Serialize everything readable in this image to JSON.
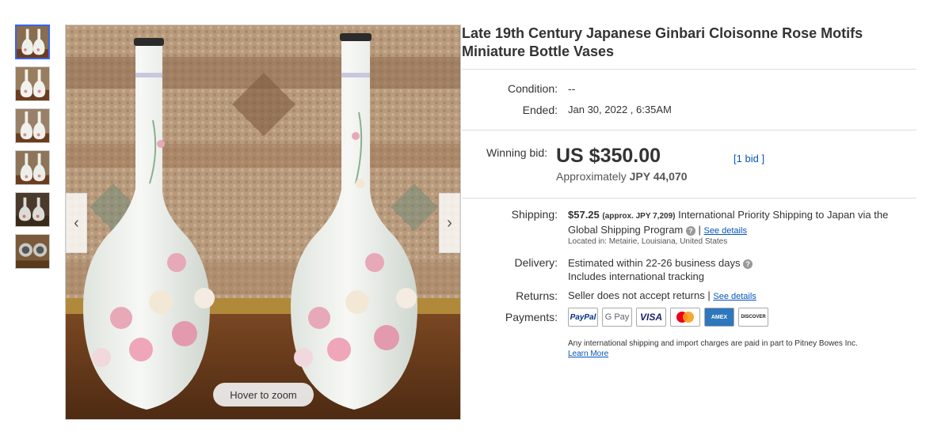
{
  "thumbnails": [
    "vase-pair-front",
    "vase-pair-side",
    "vase-pair-angle",
    "vase-pair-back",
    "vase-pair-dark",
    "vase-bottoms"
  ],
  "gallery": {
    "zoom_hint": "Hover to zoom",
    "prev_icon": "chevron-left-icon",
    "next_icon": "chevron-right-icon",
    "prev_glyph": "‹",
    "next_glyph": "›"
  },
  "listing": {
    "title": "Late 19th Century Japanese Ginbari Cloisonne Rose Motifs Miniature Bottle Vases",
    "condition_label": "Condition:",
    "condition_value": "--",
    "ended_label": "Ended:",
    "ended_value": "Jan 30, 2022 , 6:35AM",
    "winning_bid_label": "Winning bid:",
    "winning_bid_value": "US $350.00",
    "approx_prefix": "Approximately",
    "approx_value": "JPY 44,070",
    "bids_open": "[",
    "bids_link": "1 bid",
    "bids_close": "]"
  },
  "shipping": {
    "label": "Shipping:",
    "price": "$57.25",
    "approx": "(approx. JPY 7,209)",
    "method": "International Priority Shipping to Japan",
    "via": "via",
    "program": "the Global Shipping Program",
    "help_glyph": "?",
    "separator": "|",
    "see_details": "See details",
    "location": "Located in:  Metairie, Louisiana, United States"
  },
  "delivery": {
    "label": "Delivery:",
    "estimate": "Estimated within 22-26 business days",
    "help_glyph": "?",
    "tracking": "Includes international tracking"
  },
  "returns": {
    "label": "Returns:",
    "policy": "Seller does not accept returns",
    "separator": "|",
    "see_details": "See details"
  },
  "payments": {
    "label": "Payments:",
    "methods": [
      "PayPal",
      "G Pay",
      "VISA",
      "mastercard",
      "AMEX",
      "DISCOVER"
    ]
  },
  "fineprint": {
    "text": "Any international shipping and import charges are paid in part to Pitney Bowes Inc.",
    "learn_more": "Learn More"
  },
  "colors": {
    "link": "#0654ba",
    "selected_thumb": "#3665f3",
    "text": "#333333"
  }
}
